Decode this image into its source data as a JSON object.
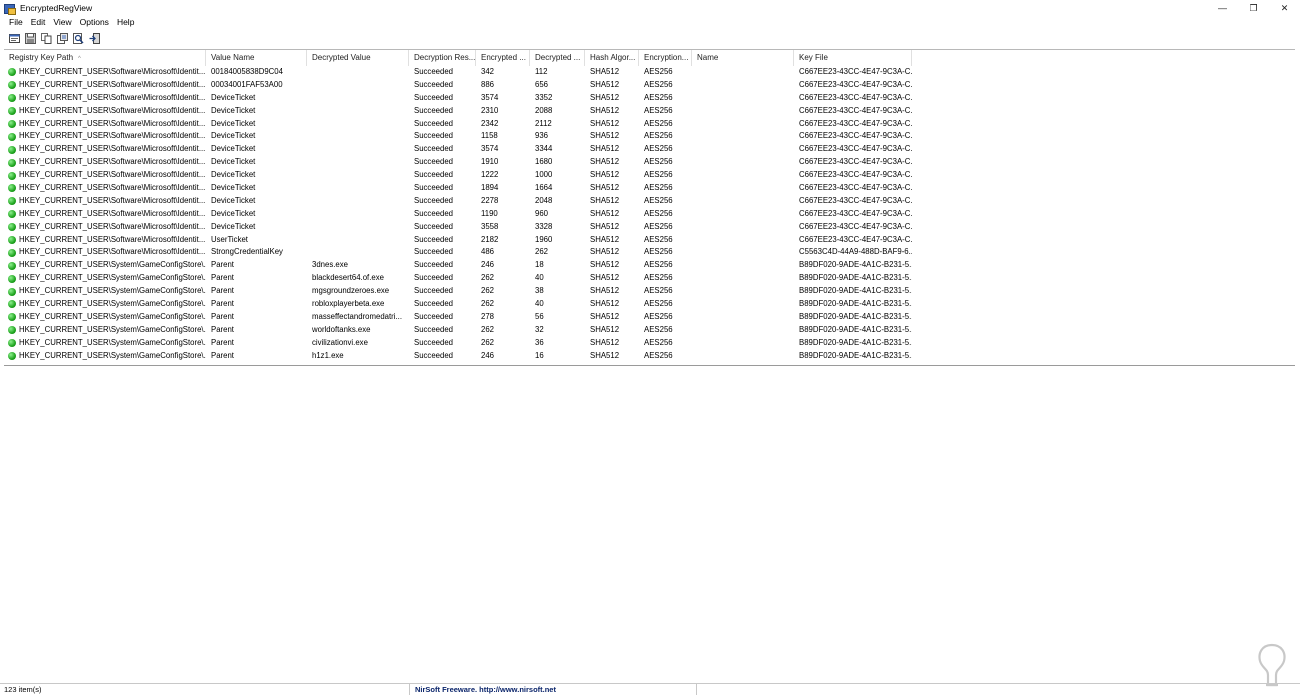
{
  "window": {
    "title": "EncryptedRegView",
    "controls": [
      "—",
      "❐",
      "✕"
    ]
  },
  "menu": [
    "File",
    "Edit",
    "View",
    "Options",
    "Help"
  ],
  "toolbar": [
    {
      "name": "properties-icon"
    },
    {
      "name": "save-icon"
    },
    {
      "name": "copy-icon"
    },
    {
      "name": "html-report-icon"
    },
    {
      "name": "find-icon"
    },
    {
      "name": "exit-icon"
    }
  ],
  "columns": [
    "Registry Key Path",
    "Value Name",
    "Decrypted Value",
    "Decryption Res...",
    "Encrypted ...",
    "Decrypted ...",
    "Hash Algor...",
    "Encryption...",
    "Name",
    "Key File"
  ],
  "sort_indicator": "^",
  "rows": [
    [
      "HKEY_CURRENT_USER\\Software\\Microsoft\\Identit...",
      "00184005838D9C04",
      "",
      "Succeeded",
      "342",
      "112",
      "SHA512",
      "AES256",
      "",
      "C667EE23-43CC-4E47-9C3A-C..."
    ],
    [
      "HKEY_CURRENT_USER\\Software\\Microsoft\\Identit...",
      "00034001FAF53A00",
      "",
      "Succeeded",
      "886",
      "656",
      "SHA512",
      "AES256",
      "",
      "C667EE23-43CC-4E47-9C3A-C..."
    ],
    [
      "HKEY_CURRENT_USER\\Software\\Microsoft\\Identit...",
      "DeviceTicket",
      "",
      "Succeeded",
      "3574",
      "3352",
      "SHA512",
      "AES256",
      "",
      "C667EE23-43CC-4E47-9C3A-C..."
    ],
    [
      "HKEY_CURRENT_USER\\Software\\Microsoft\\Identit...",
      "DeviceTicket",
      "",
      "Succeeded",
      "2310",
      "2088",
      "SHA512",
      "AES256",
      "",
      "C667EE23-43CC-4E47-9C3A-C..."
    ],
    [
      "HKEY_CURRENT_USER\\Software\\Microsoft\\Identit...",
      "DeviceTicket",
      "",
      "Succeeded",
      "2342",
      "2112",
      "SHA512",
      "AES256",
      "",
      "C667EE23-43CC-4E47-9C3A-C..."
    ],
    [
      "HKEY_CURRENT_USER\\Software\\Microsoft\\Identit...",
      "DeviceTicket",
      "",
      "Succeeded",
      "1158",
      "936",
      "SHA512",
      "AES256",
      "",
      "C667EE23-43CC-4E47-9C3A-C..."
    ],
    [
      "HKEY_CURRENT_USER\\Software\\Microsoft\\Identit...",
      "DeviceTicket",
      "",
      "Succeeded",
      "3574",
      "3344",
      "SHA512",
      "AES256",
      "",
      "C667EE23-43CC-4E47-9C3A-C..."
    ],
    [
      "HKEY_CURRENT_USER\\Software\\Microsoft\\Identit...",
      "DeviceTicket",
      "",
      "Succeeded",
      "1910",
      "1680",
      "SHA512",
      "AES256",
      "",
      "C667EE23-43CC-4E47-9C3A-C..."
    ],
    [
      "HKEY_CURRENT_USER\\Software\\Microsoft\\Identit...",
      "DeviceTicket",
      "",
      "Succeeded",
      "1222",
      "1000",
      "SHA512",
      "AES256",
      "",
      "C667EE23-43CC-4E47-9C3A-C..."
    ],
    [
      "HKEY_CURRENT_USER\\Software\\Microsoft\\Identit...",
      "DeviceTicket",
      "",
      "Succeeded",
      "1894",
      "1664",
      "SHA512",
      "AES256",
      "",
      "C667EE23-43CC-4E47-9C3A-C..."
    ],
    [
      "HKEY_CURRENT_USER\\Software\\Microsoft\\Identit...",
      "DeviceTicket",
      "",
      "Succeeded",
      "2278",
      "2048",
      "SHA512",
      "AES256",
      "",
      "C667EE23-43CC-4E47-9C3A-C..."
    ],
    [
      "HKEY_CURRENT_USER\\Software\\Microsoft\\Identit...",
      "DeviceTicket",
      "",
      "Succeeded",
      "1190",
      "960",
      "SHA512",
      "AES256",
      "",
      "C667EE23-43CC-4E47-9C3A-C..."
    ],
    [
      "HKEY_CURRENT_USER\\Software\\Microsoft\\Identit...",
      "DeviceTicket",
      "",
      "Succeeded",
      "3558",
      "3328",
      "SHA512",
      "AES256",
      "",
      "C667EE23-43CC-4E47-9C3A-C..."
    ],
    [
      "HKEY_CURRENT_USER\\Software\\Microsoft\\Identit...",
      "UserTicket",
      "",
      "Succeeded",
      "2182",
      "1960",
      "SHA512",
      "AES256",
      "",
      "C667EE23-43CC-4E47-9C3A-C..."
    ],
    [
      "HKEY_CURRENT_USER\\Software\\Microsoft\\Identit...",
      "StrongCredentialKey",
      "",
      "Succeeded",
      "486",
      "262",
      "SHA512",
      "AES256",
      "",
      "C5563C4D-44A9-488D-BAF9-6..."
    ],
    [
      "HKEY_CURRENT_USER\\System\\GameConfigStore\\...",
      "Parent",
      "3dnes.exe",
      "Succeeded",
      "246",
      "18",
      "SHA512",
      "AES256",
      "",
      "B89DF020-9ADE-4A1C-B231-5..."
    ],
    [
      "HKEY_CURRENT_USER\\System\\GameConfigStore\\...",
      "Parent",
      "blackdesert64.of.exe",
      "Succeeded",
      "262",
      "40",
      "SHA512",
      "AES256",
      "",
      "B89DF020-9ADE-4A1C-B231-5..."
    ],
    [
      "HKEY_CURRENT_USER\\System\\GameConfigStore\\...",
      "Parent",
      "mgsgroundzeroes.exe",
      "Succeeded",
      "262",
      "38",
      "SHA512",
      "AES256",
      "",
      "B89DF020-9ADE-4A1C-B231-5..."
    ],
    [
      "HKEY_CURRENT_USER\\System\\GameConfigStore\\...",
      "Parent",
      "robloxplayerbeta.exe",
      "Succeeded",
      "262",
      "40",
      "SHA512",
      "AES256",
      "",
      "B89DF020-9ADE-4A1C-B231-5..."
    ],
    [
      "HKEY_CURRENT_USER\\System\\GameConfigStore\\...",
      "Parent",
      "masseffectandromedatri...",
      "Succeeded",
      "278",
      "56",
      "SHA512",
      "AES256",
      "",
      "B89DF020-9ADE-4A1C-B231-5..."
    ],
    [
      "HKEY_CURRENT_USER\\System\\GameConfigStore\\...",
      "Parent",
      "worldoftanks.exe",
      "Succeeded",
      "262",
      "32",
      "SHA512",
      "AES256",
      "",
      "B89DF020-9ADE-4A1C-B231-5..."
    ],
    [
      "HKEY_CURRENT_USER\\System\\GameConfigStore\\...",
      "Parent",
      "civilizationvi.exe",
      "Succeeded",
      "262",
      "36",
      "SHA512",
      "AES256",
      "",
      "B89DF020-9ADE-4A1C-B231-5..."
    ],
    [
      "HKEY_CURRENT_USER\\System\\GameConfigStore\\...",
      "Parent",
      "h1z1.exe",
      "Succeeded",
      "246",
      "16",
      "SHA512",
      "AES256",
      "",
      "B89DF020-9ADE-4A1C-B231-5..."
    ]
  ],
  "statusbar": {
    "items_count": "123 item(s)",
    "credit": "NirSoft Freeware.  http://www.nirsoft.net"
  },
  "colors": {
    "status_ok": "#1fa51f",
    "credit_text": "#0a246a"
  }
}
